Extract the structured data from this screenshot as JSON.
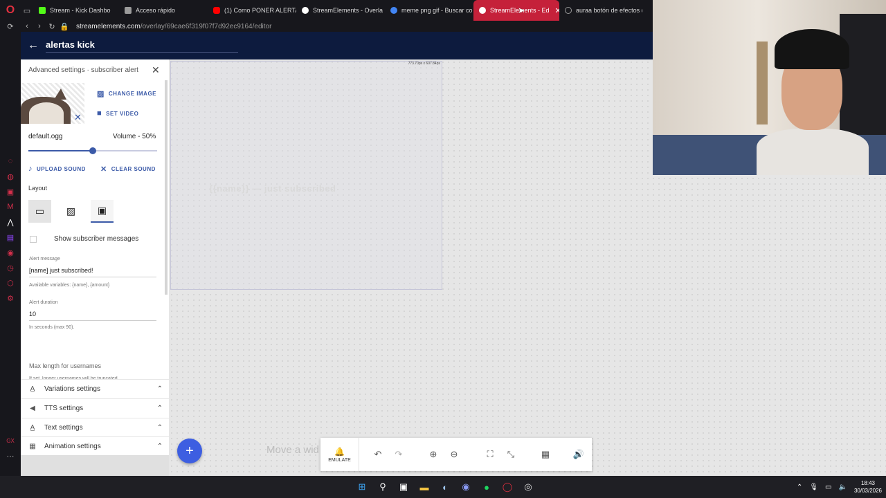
{
  "browser": {
    "tabs": [
      {
        "title": "Stream - Kick Dashbo",
        "fav_color": "#53fc18"
      },
      {
        "title": "Acceso rápido",
        "fav_color": "#9b9b9b"
      },
      {
        "title": "(1) Como PONER ALERTA",
        "fav_color": "#ff0000"
      },
      {
        "title": "StreamElements - Overla",
        "fav_color": "#ffffff"
      },
      {
        "title": "meme png gif - Buscar co",
        "fav_color": "#4285f4"
      },
      {
        "title": "StreamElements - Ed",
        "fav_color": "#ffffff"
      },
      {
        "title": "auraa botón de efectos d",
        "fav_color": "#9b9b9b"
      }
    ],
    "active_tab_index": 5,
    "url_host": "streamelements.com",
    "url_path": "/overlay/69cae6f319f07f7d92ec9164/editor",
    "accent": "#c5213a"
  },
  "app": {
    "title": "alertas kick",
    "header_color": "#0d1b3e"
  },
  "panel": {
    "heading": "Advanced settings · subscriber alert",
    "change_image": "CHANGE IMAGE",
    "set_video": "SET VIDEO",
    "sound_file": "default.ogg",
    "volume_label": "Volume - 50%",
    "volume": 0.5,
    "upload_sound": "UPLOAD SOUND",
    "clear_sound": "CLEAR SOUND",
    "layout_label": "Layout",
    "show_messages": "Show subscriber messages",
    "alert_message_label": "Alert message",
    "alert_message_value": "[name] just subscribed!",
    "variables_hint": "Available variables: {name}, {amount}",
    "duration_label": "Alert duration",
    "duration_value": "10",
    "duration_hint": "In seconds (max 90).",
    "max_length_label": "Max length for usernames",
    "max_length_hint": "If set, longer usernames will be truncated",
    "sections": [
      {
        "label": "Variations settings",
        "icon": "A"
      },
      {
        "label": "TTS settings",
        "icon": "🔈"
      },
      {
        "label": "Text settings",
        "icon": "A"
      },
      {
        "label": "Animation settings",
        "icon": "▦"
      }
    ]
  },
  "canvas": {
    "widget_size": "773.70px x 607.84px",
    "ghost_text": "{{name}} — just subscribed",
    "move_hint": "Move a wid"
  },
  "toolbar": {
    "emulate": "EMULATE"
  },
  "taskbar": {
    "time": "18:43",
    "date": "30/03/2026"
  }
}
